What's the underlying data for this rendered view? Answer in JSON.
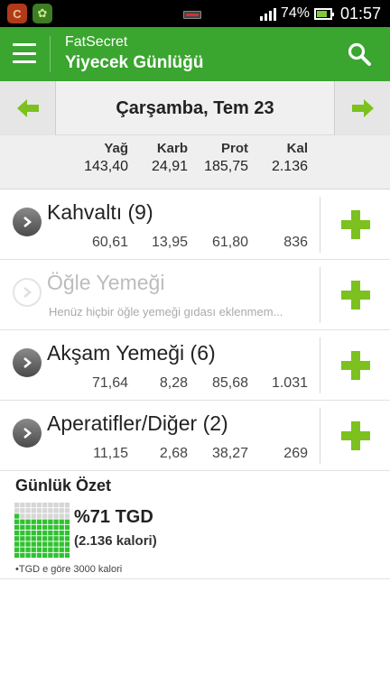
{
  "status_bar": {
    "battery": "74%",
    "time": "01:57"
  },
  "action_bar": {
    "app_name": "FatSecret",
    "title": "Yiyecek Günlüğü",
    "icons": [
      "menu-icon",
      "search-icon"
    ]
  },
  "date_nav": {
    "date": "Çarşamba, Tem 23"
  },
  "totals": {
    "headers": [
      "Yağ",
      "Karb",
      "Prot",
      "Kal"
    ],
    "values": [
      "143,40",
      "24,91",
      "185,75",
      "2.136"
    ]
  },
  "meals": [
    {
      "title": "Kahvaltı (9)",
      "values": [
        "60,61",
        "13,95",
        "61,80",
        "836"
      ],
      "active": true
    },
    {
      "title": "Öğle Yemeği",
      "empty_text": "Henüz hiçbir öğle yemeği gıdası eklenmem...",
      "active": false
    },
    {
      "title": "Akşam Yemeği (6)",
      "values": [
        "71,64",
        "8,28",
        "85,68",
        "1.031"
      ],
      "active": true
    },
    {
      "title": "Aperatifler/Diğer (2)",
      "values": [
        "11,15",
        "2,68",
        "38,27",
        "269"
      ],
      "active": true
    }
  ],
  "summary": {
    "title": "Günlük Özet",
    "percent": "%71 TGD",
    "calories": "(2.136 kalori)",
    "footnote": "•TGD e göre 3000 kalori",
    "fill_fraction": 0.71
  },
  "colors": {
    "accent": "#3aa52f",
    "plus": "#7cc11f",
    "grid_on": "#2fc22f",
    "grid_off": "#d6d6d6"
  }
}
